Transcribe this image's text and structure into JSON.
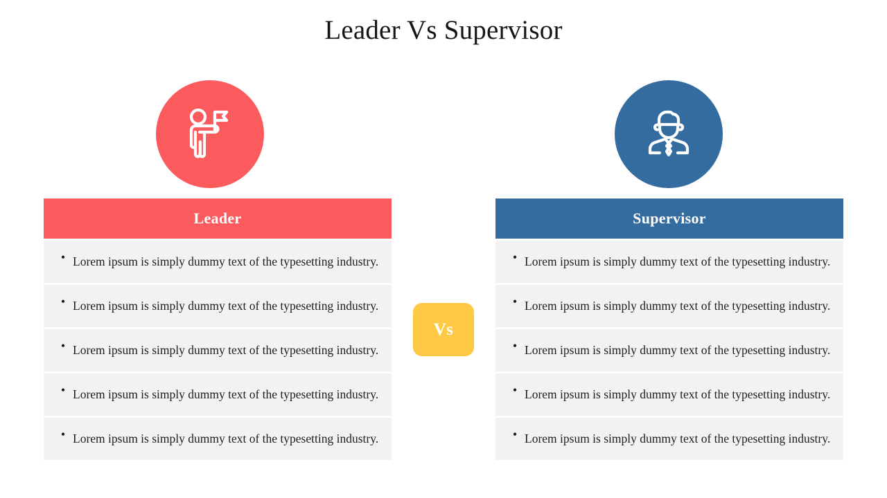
{
  "slide": {
    "title": "Leader Vs Supervisor",
    "background_color": "#FFFFFF"
  },
  "colors": {
    "leader": "#FB5B5D",
    "supervisor": "#356C9F",
    "vs_badge": "#FFC845",
    "row_background": "#F2F2F2",
    "header_text": "#FFFFFF",
    "body_text": "#1E1E1E",
    "title_text": "#151515"
  },
  "vs_badge": {
    "label": "Vs"
  },
  "columns": [
    {
      "key": "leader",
      "icon_name": "leader-flag-person-icon",
      "header": "Leader",
      "accent_color": "#FB5B5D",
      "items": [
        "Lorem ipsum is simply dummy text of the typesetting industry.",
        "Lorem ipsum is simply dummy text of the typesetting industry.",
        "Lorem ipsum is simply dummy text of the typesetting industry.",
        "Lorem ipsum is simply dummy text of the typesetting industry.",
        "Lorem ipsum is simply dummy text of the typesetting industry."
      ],
      "bullet": "•"
    },
    {
      "key": "supervisor",
      "icon_name": "supervisor-businessperson-icon",
      "header": "Supervisor",
      "accent_color": "#356C9F",
      "items": [
        "Lorem ipsum is simply dummy text of the typesetting industry.",
        "Lorem ipsum is simply dummy text of the typesetting industry.",
        "Lorem ipsum is simply dummy text of the typesetting industry.",
        "Lorem ipsum is simply dummy text of the typesetting industry.",
        "Lorem ipsum is simply dummy text of the typesetting industry."
      ],
      "bullet": "•"
    }
  ]
}
